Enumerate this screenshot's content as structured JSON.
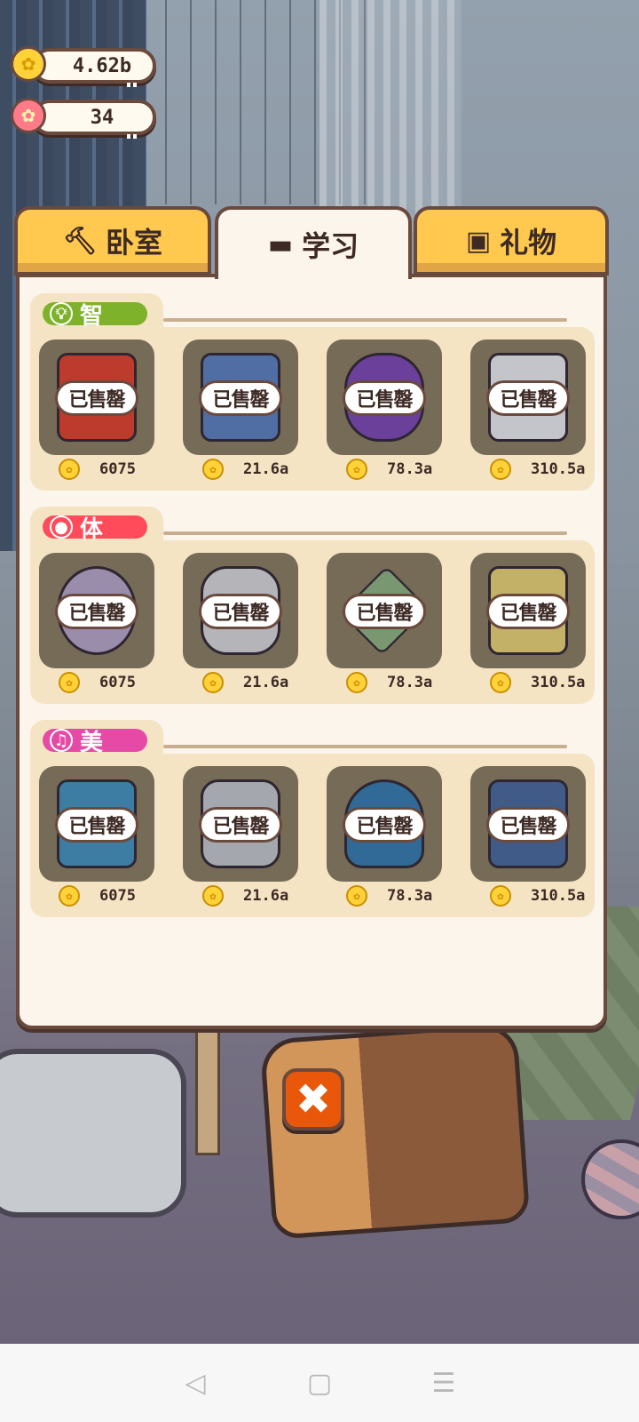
{
  "hud": {
    "coins": "4.62b",
    "flowers": "34"
  },
  "tabs": [
    {
      "label": "卧室",
      "icon": "hammer-icon"
    },
    {
      "label": "学习",
      "icon": "graduation-cap-icon"
    },
    {
      "label": "礼物",
      "icon": "gift-icon"
    }
  ],
  "active_tab": "学习",
  "sold_label": "已售罄",
  "sections": [
    {
      "label": "智",
      "icon": "lightbulb-icon",
      "color": "#7db22a",
      "items": [
        {
          "name": "book",
          "price": "6075"
        },
        {
          "name": "early-education-sign",
          "price": "21.6a"
        },
        {
          "name": "purple-doll",
          "price": "78.3a"
        },
        {
          "name": "milk-can",
          "price": "310.5a"
        }
      ]
    },
    {
      "label": "体",
      "icon": "basketball-icon",
      "color": "#ff4b5a",
      "items": [
        {
          "name": "ball",
          "price": "6075"
        },
        {
          "name": "cat-bed",
          "price": "21.6a"
        },
        {
          "name": "mat",
          "price": "78.3a"
        },
        {
          "name": "tent",
          "price": "310.5a"
        }
      ]
    },
    {
      "label": "美",
      "icon": "music-note-icon",
      "color": "#e64aa7",
      "items": [
        {
          "name": "picture-book",
          "price": "6075"
        },
        {
          "name": "tray",
          "price": "21.6a"
        },
        {
          "name": "vase",
          "price": "78.3a"
        },
        {
          "name": "stroller",
          "price": "310.5a"
        }
      ]
    }
  ],
  "close_label": "✖",
  "navbar": [
    "back-icon",
    "home-icon",
    "menu-icon"
  ]
}
